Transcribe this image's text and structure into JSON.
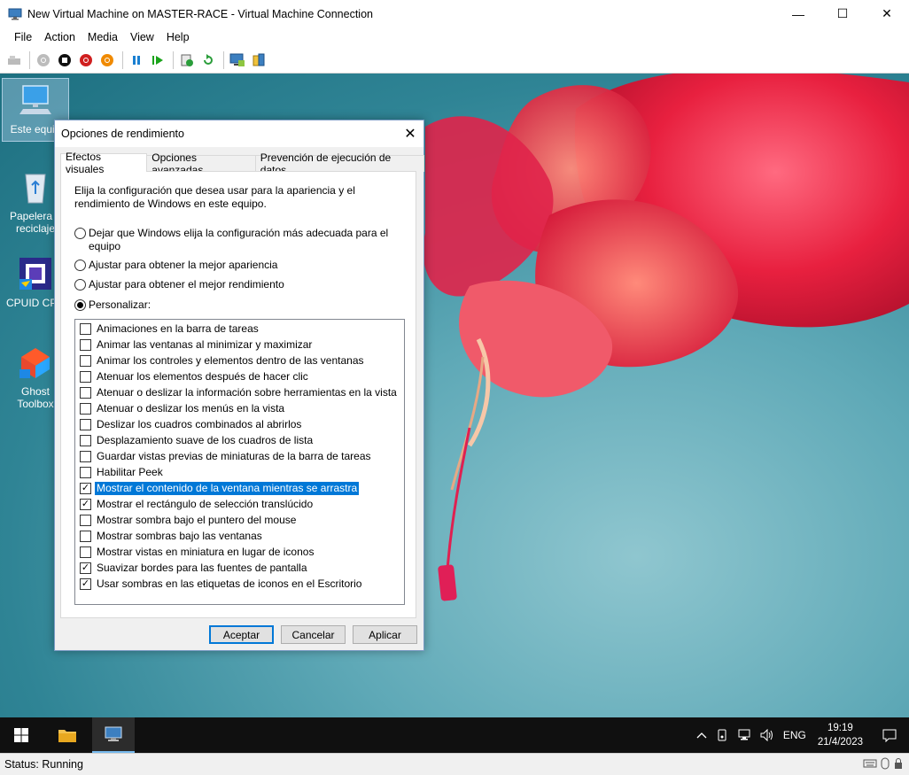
{
  "window": {
    "title": "New Virtual Machine on MASTER-RACE - Virtual Machine Connection",
    "minimize": "—",
    "maximize": "☐",
    "close": "✕"
  },
  "menu": [
    "File",
    "Action",
    "Media",
    "View",
    "Help"
  ],
  "toolbar": {
    "buttons": [
      "ctrl-alt-del-icon",
      "start-icon",
      "turn-off-icon",
      "shut-down-icon",
      "save-icon",
      "pause-icon",
      "resume-icon",
      "checkpoint-icon",
      "revert-icon",
      "enhanced-session-icon",
      "share-icon"
    ]
  },
  "desktop_icons": [
    {
      "label": "Este equip",
      "icon": "computer-icon"
    },
    {
      "label": "Papelera d reciclaje",
      "icon": "recycle-bin-icon"
    },
    {
      "label": "CPUID CPU",
      "icon": "cpuid-icon"
    },
    {
      "label": "Ghost Toolbox",
      "icon": "ghost-toolbox-icon"
    }
  ],
  "dialog": {
    "title": "Opciones de rendimiento",
    "close": "✕",
    "tabs": [
      "Efectos visuales",
      "Opciones avanzadas",
      "Prevención de ejecución de datos"
    ],
    "description": "Elija la configuración que desea usar para la apariencia y el rendimiento de Windows en este equipo.",
    "radios": [
      {
        "label": "Dejar que Windows elija la configuración más adecuada para el equipo",
        "checked": false
      },
      {
        "label": "Ajustar para obtener la mejor apariencia",
        "checked": false
      },
      {
        "label": "Ajustar para obtener el mejor rendimiento",
        "checked": false
      },
      {
        "label": "Personalizar:",
        "checked": true
      }
    ],
    "options": [
      {
        "label": "Animaciones en la barra de tareas",
        "checked": false
      },
      {
        "label": "Animar las ventanas al minimizar y maximizar",
        "checked": false
      },
      {
        "label": "Animar los controles y elementos dentro de las ventanas",
        "checked": false
      },
      {
        "label": "Atenuar los elementos después de hacer clic",
        "checked": false
      },
      {
        "label": "Atenuar o deslizar la información sobre herramientas en la vista",
        "checked": false
      },
      {
        "label": "Atenuar o deslizar los menús en la vista",
        "checked": false
      },
      {
        "label": "Deslizar los cuadros combinados al abrirlos",
        "checked": false
      },
      {
        "label": "Desplazamiento suave de los cuadros de lista",
        "checked": false
      },
      {
        "label": "Guardar vistas previas de miniaturas de la barra de tareas",
        "checked": false
      },
      {
        "label": "Habilitar Peek",
        "checked": false
      },
      {
        "label": "Mostrar el contenido de la ventana mientras se arrastra",
        "checked": true,
        "selected": true
      },
      {
        "label": "Mostrar el rectángulo de selección translúcido",
        "checked": true
      },
      {
        "label": "Mostrar sombra bajo el puntero del mouse",
        "checked": false
      },
      {
        "label": "Mostrar sombras bajo las ventanas",
        "checked": false
      },
      {
        "label": "Mostrar vistas en miniatura en lugar de iconos",
        "checked": false
      },
      {
        "label": "Suavizar bordes para las fuentes de pantalla",
        "checked": true
      },
      {
        "label": "Usar sombras en las etiquetas de iconos en el Escritorio",
        "checked": true
      }
    ],
    "buttons": {
      "ok": "Aceptar",
      "cancel": "Cancelar",
      "apply": "Aplicar"
    }
  },
  "taskbar": {
    "items": [
      "start-icon",
      "file-explorer-icon",
      "vm-connection-icon"
    ],
    "language": "ENG",
    "time": "19:19",
    "date": "21/4/2023"
  },
  "status": "Status: Running",
  "colors": {
    "accent": "#0078d7",
    "taskbar": "#101010",
    "desktop": "#2f8495"
  }
}
